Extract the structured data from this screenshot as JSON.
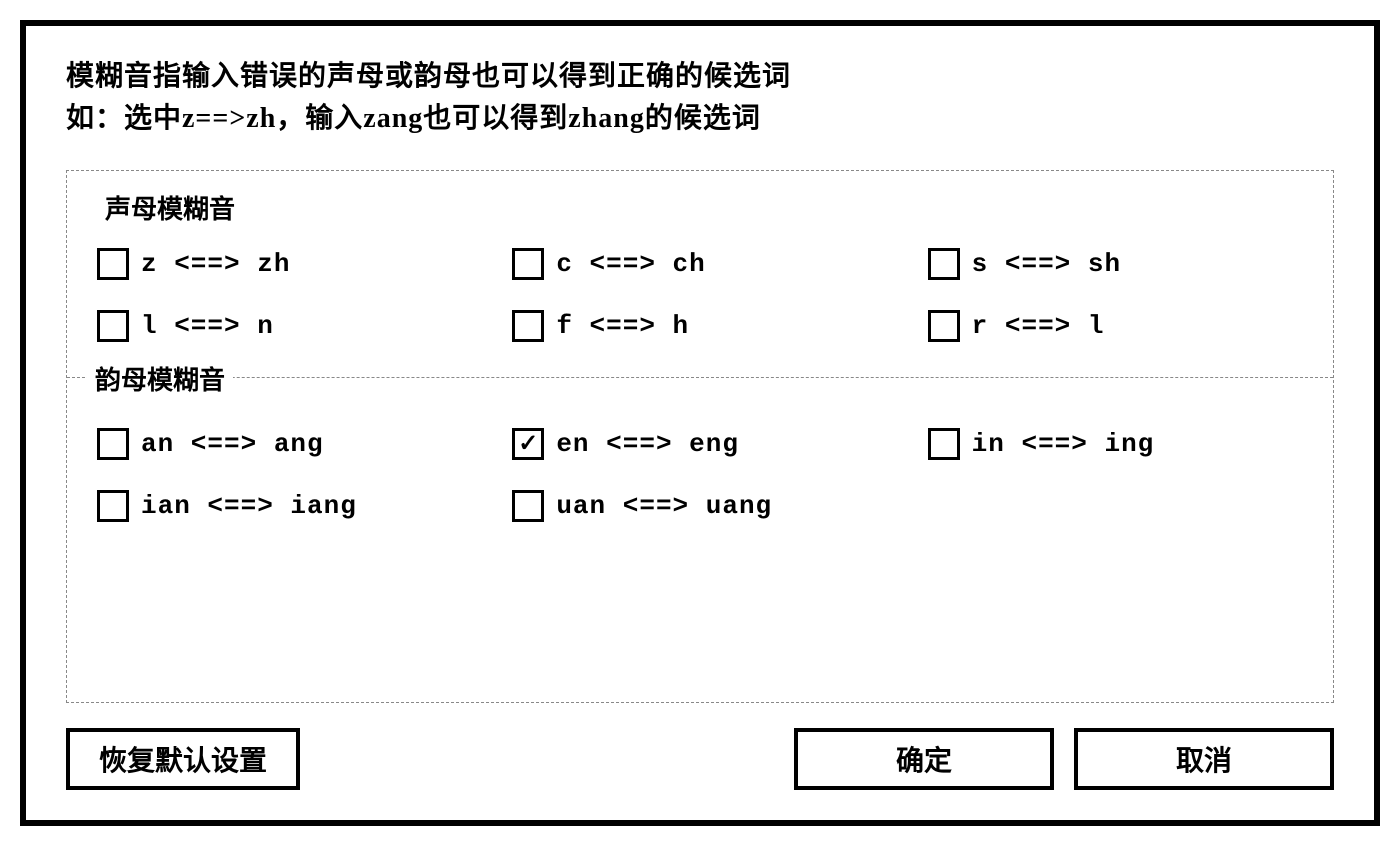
{
  "description": {
    "line1": "模糊音指输入错误的声母或韵母也可以得到正确的候选词",
    "line2": "如：选中z==>zh，输入zang也可以得到zhang的候选词"
  },
  "groups": {
    "initials": {
      "title": "声母模糊音",
      "items": [
        {
          "label": "z <==> zh",
          "checked": false
        },
        {
          "label": "c <==> ch",
          "checked": false
        },
        {
          "label": "s <==> sh",
          "checked": false
        },
        {
          "label": "l <==> n",
          "checked": false
        },
        {
          "label": "f <==> h",
          "checked": false
        },
        {
          "label": "r <==> l",
          "checked": false
        }
      ]
    },
    "finals": {
      "title": "韵母模糊音",
      "items": [
        {
          "label": "an <==> ang",
          "checked": false
        },
        {
          "label": "en <==> eng",
          "checked": true
        },
        {
          "label": "in <==> ing",
          "checked": false
        },
        {
          "label": "ian <==> iang",
          "checked": false
        },
        {
          "label": "uan <==> uang",
          "checked": false
        }
      ]
    }
  },
  "buttons": {
    "reset": "恢复默认设置",
    "ok": "确定",
    "cancel": "取消"
  }
}
